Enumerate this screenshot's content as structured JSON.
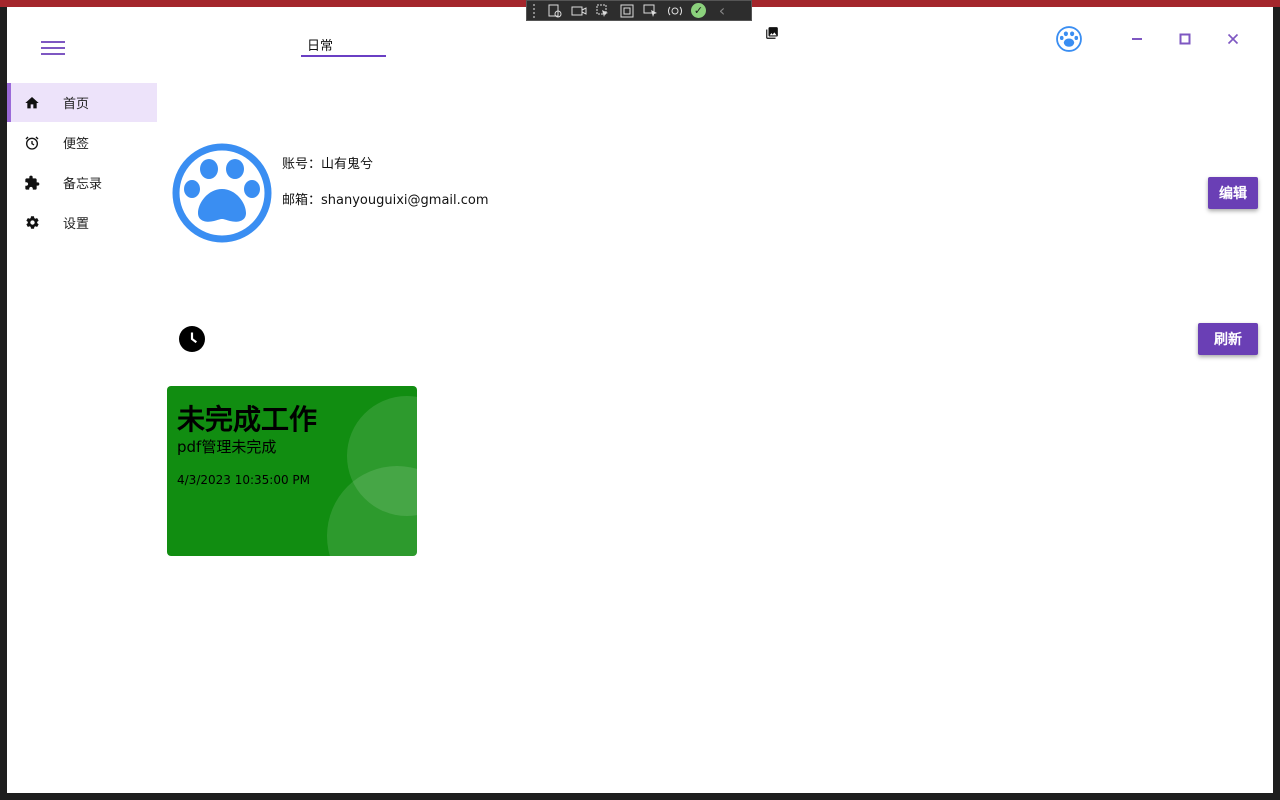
{
  "header": {
    "tab_label": "日常",
    "menu_icon": "hamburger-menu-icon",
    "gallery_icon": "image-gallery-icon",
    "avatar_icon": "paw-avatar-icon",
    "window_controls": [
      "minimize-icon",
      "maximize-icon",
      "close-icon"
    ]
  },
  "sidebar": {
    "items": [
      {
        "label": "首页",
        "icon": "home-icon",
        "active": true
      },
      {
        "label": "便签",
        "icon": "alarm-clock-icon",
        "active": false
      },
      {
        "label": "备忘录",
        "icon": "puzzle-icon",
        "active": false
      },
      {
        "label": "设置",
        "icon": "gear-icon",
        "active": false
      }
    ]
  },
  "profile": {
    "account_label": "账号：",
    "account_value": "山有鬼兮",
    "email_label": "邮箱：",
    "email_value": "shanyouguixi@gmail.com",
    "edit_button": "编辑"
  },
  "tasks": {
    "refresh_button": "刷新",
    "cards": [
      {
        "title": "未完成工作",
        "content": "pdf管理未完成",
        "time": "4/3/2023 10:35:00 PM",
        "color": "#118d11"
      }
    ]
  },
  "colors": {
    "accent": "#6a3fb5",
    "accent_light": "#ede3fa",
    "titlebar": "#a4262c",
    "paw_blue": "#3a8ef2"
  }
}
